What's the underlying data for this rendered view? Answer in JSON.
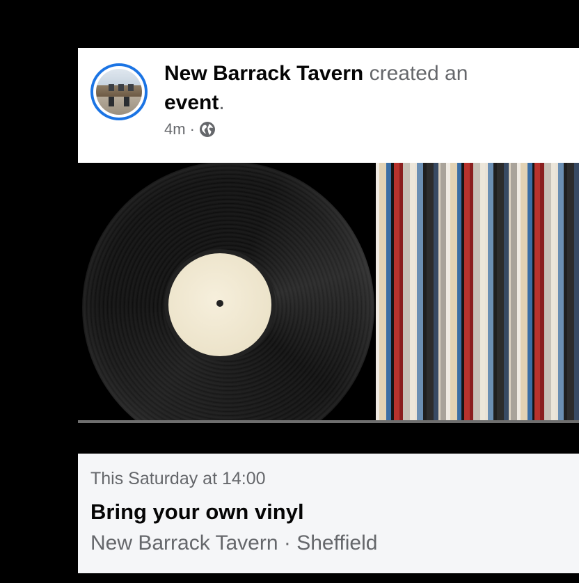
{
  "post": {
    "author": "New Barrack Tavern",
    "action": "created an",
    "object": "event",
    "period": ".",
    "time": "4m",
    "separator": "·",
    "audience_icon": "globe-icon"
  },
  "photo": {
    "subject_icon": "vinyl-record-photo"
  },
  "event": {
    "date": "This Saturday at 14:00",
    "title": "Bring your own vinyl",
    "location": "New Barrack Tavern · Sheffield"
  },
  "colors": {
    "accent": "#1b74e4",
    "muted_text": "#65676b",
    "event_bg": "#f5f6f8"
  }
}
